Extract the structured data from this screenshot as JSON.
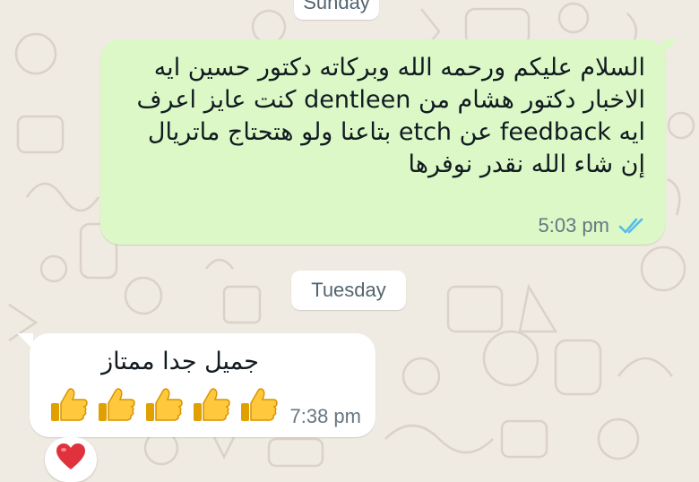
{
  "chat": {
    "date_top": "Sunday",
    "date_mid": "Tuesday",
    "outgoing": {
      "lines": [
        "السلام عليكم ورحمه الله وبركاته دكتور حسين ايه",
        "الاخبار دكتور هشام من dentleen كنت عايز اعرف",
        "ايه feedback عن etch بتاعنا ولو هتحتاج ماتريال",
        "إن شاء الله نقدر نوفرها"
      ],
      "time": "5:03 pm",
      "status_icon": "double-check-read-icon"
    },
    "incoming": {
      "text": "جميل جدا ممتاز",
      "emoji": "thumbs-up-icon ×5",
      "time": "7:38 pm",
      "reaction_icon": "red-heart-icon"
    }
  },
  "colors": {
    "outgoing_bubble": "#dcf8c6",
    "incoming_bubble": "#ffffff",
    "background": "#efeae2",
    "tick_blue": "#53bdeb"
  }
}
